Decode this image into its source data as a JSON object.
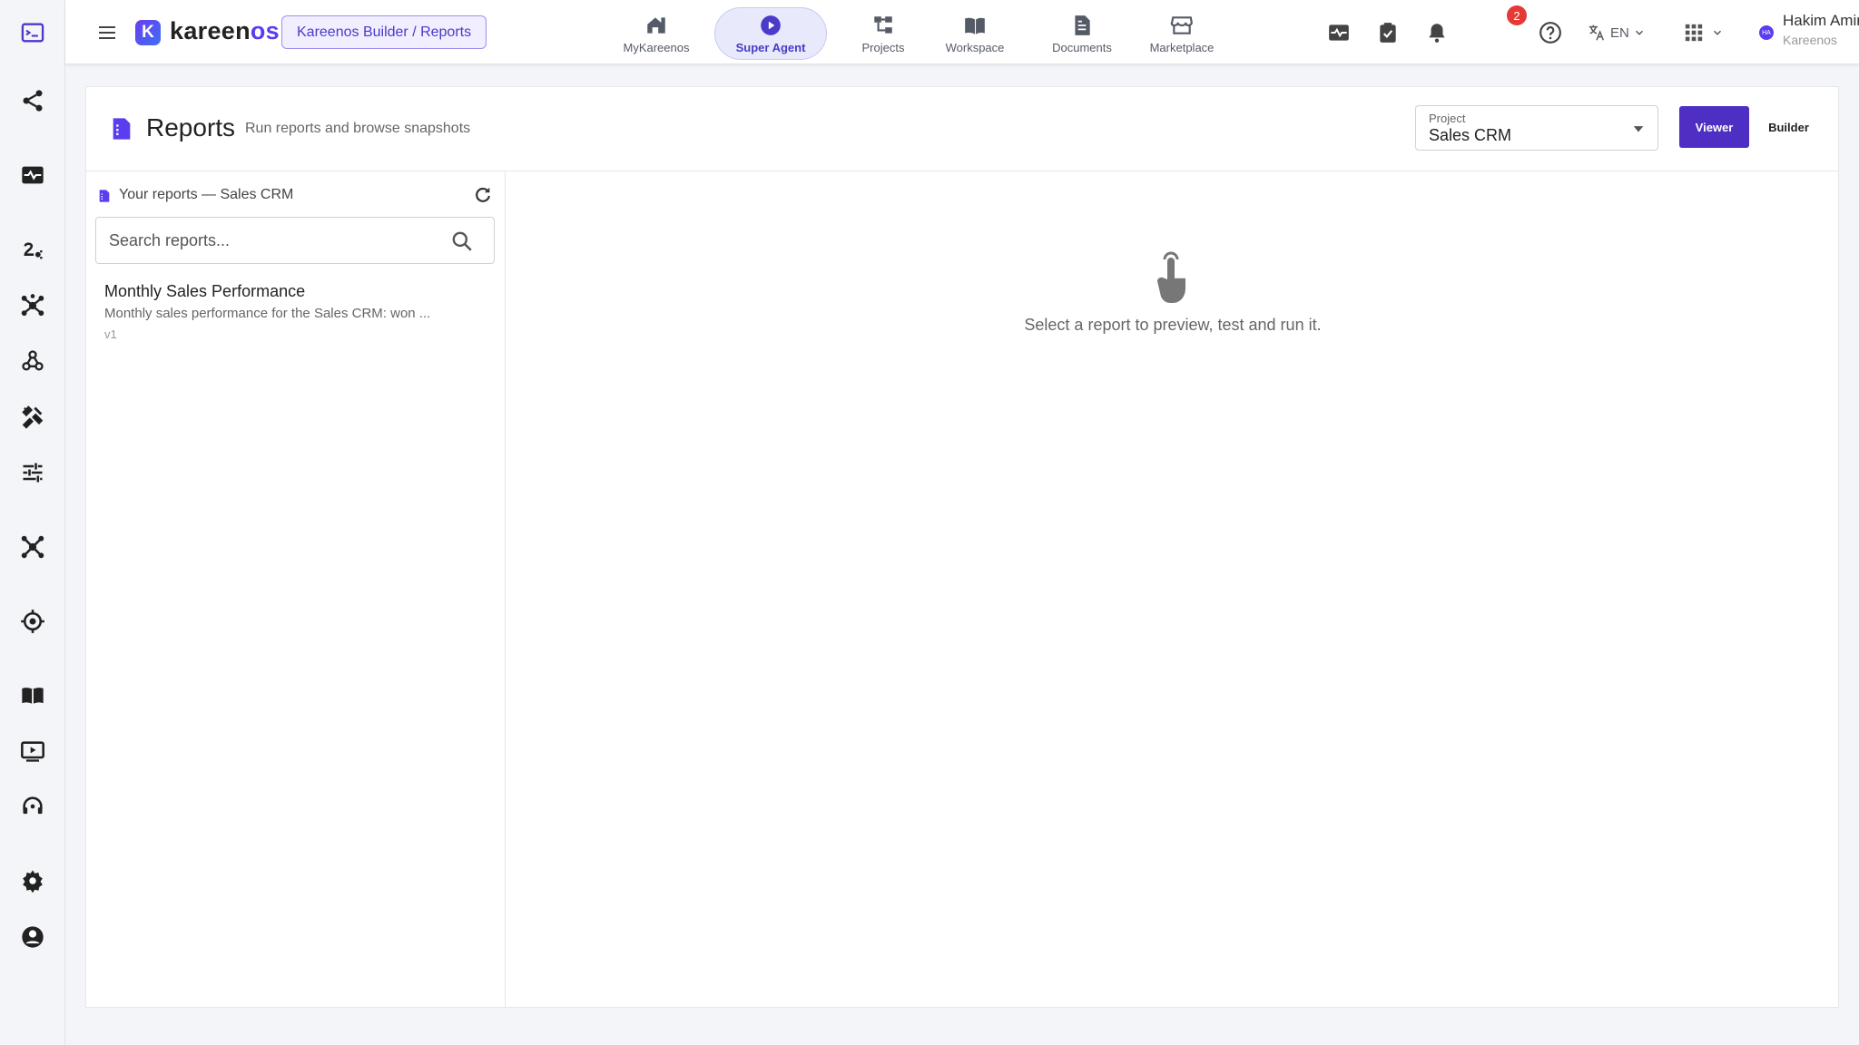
{
  "rail": {
    "icons": [
      "console-icon",
      "share-icon",
      "monitor-heart-icon",
      "route-icon",
      "hub-icon",
      "webhook-icon",
      "tools-icon",
      "tune-icon",
      "hub-alt-icon",
      "target-icon",
      "book-icon",
      "video-icon",
      "support-icon",
      "settings-icon",
      "account-icon"
    ]
  },
  "header": {
    "brand": "kareen",
    "brand_suffix": "os",
    "brand_mark": "K",
    "breadcrumb": "Kareenos Builder / Reports",
    "nav": [
      {
        "label": "MyKareenos",
        "icon": "home-icon"
      },
      {
        "label": "Super Agent",
        "icon": "play-circle-icon",
        "active": true
      },
      {
        "label": "Projects",
        "icon": "tree-icon"
      },
      {
        "label": "Workspace",
        "icon": "library-icon"
      },
      {
        "label": "Documents",
        "icon": "document-icon"
      },
      {
        "label": "Marketplace",
        "icon": "store-icon"
      }
    ],
    "notifications_count": "2",
    "language": "EN",
    "user": {
      "name": "Hakim Amir",
      "org": "Kareenos",
      "initials": "HA"
    }
  },
  "page": {
    "title": "Reports",
    "subtitle": "Run reports and browse snapshots",
    "project_label": "Project",
    "project_value": "Sales CRM",
    "view_modes": {
      "viewer": "Viewer",
      "builder": "Builder",
      "active": "Viewer"
    }
  },
  "reports_panel": {
    "heading": "Your reports — Sales CRM",
    "search_placeholder": "Search reports...",
    "items": [
      {
        "title": "Monthly Sales Performance",
        "description": "Monthly sales performance for the Sales CRM: won ...",
        "version": "v1"
      }
    ]
  },
  "preview": {
    "empty_message": "Select a report to preview, test and run it."
  },
  "colors": {
    "accent": "#4f2ec4",
    "brand": "#5b3df0",
    "badge": "#e53935"
  }
}
